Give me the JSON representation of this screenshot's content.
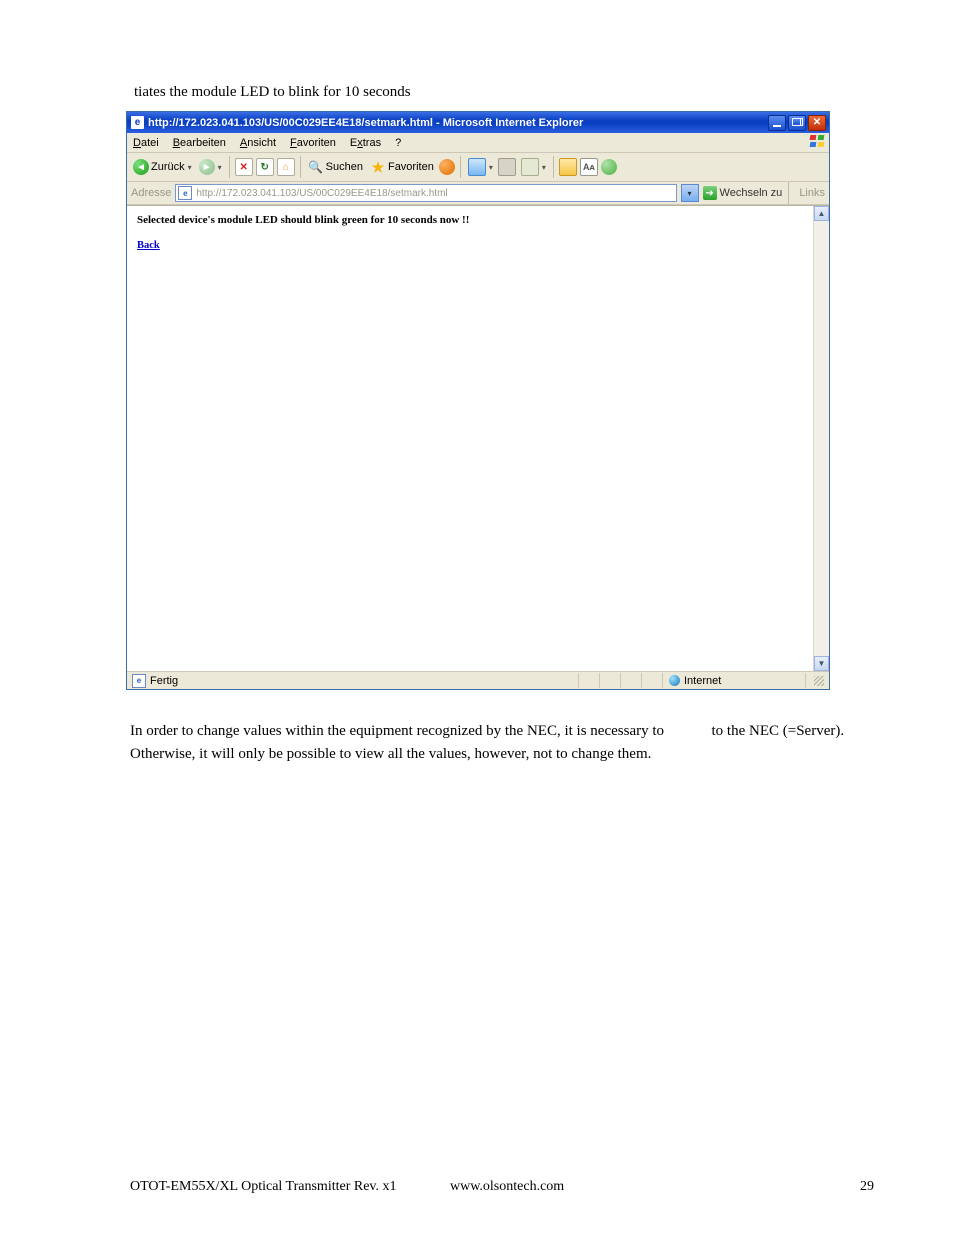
{
  "caption": "tiates the module LED to blink for 10 seconds",
  "ie": {
    "title": "http://172.023.041.103/US/00C029EE4E18/setmark.html - Microsoft Internet Explorer",
    "menus": {
      "datei": "Datei",
      "bearbeiten": "Bearbeiten",
      "ansicht": "Ansicht",
      "favoriten": "Favoriten",
      "extras": "Extras",
      "hilfe": "?"
    },
    "toolbar": {
      "back": "Zurück",
      "search": "Suchen",
      "favorites": "Favoriten"
    },
    "address": {
      "label": "Adresse",
      "url": "http://172.023.041.103/US/00C029EE4E18/setmark.html",
      "go": "Wechseln zu",
      "links": "Links"
    },
    "page": {
      "message": "Selected device's module LED should blink green for 10 seconds now !!",
      "back_link": "Back"
    },
    "status": {
      "done": "Fertig",
      "zone": "Internet"
    }
  },
  "paragraph": {
    "line1a": "In order to change values within the equipment recognized by the NEC, it is necessary to ",
    "line1b": " to the NEC (=Server).",
    "line2": "Otherwise, it will only be possible to view all the values, however, not to change them."
  },
  "footer": {
    "left": "OTOT-EM55X/XL Optical Transmitter Rev. x1",
    "center": "www.olsontech.com",
    "page": "29"
  }
}
